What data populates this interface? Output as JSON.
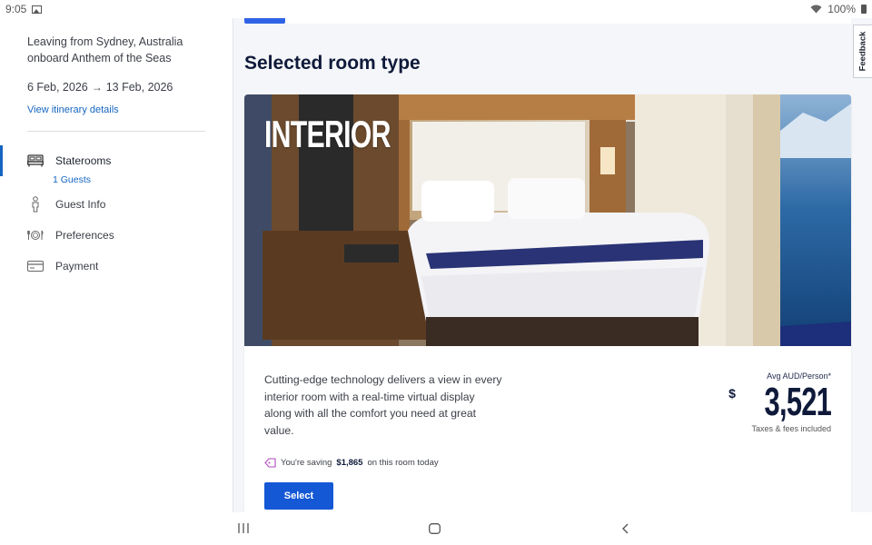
{
  "status_bar": {
    "time": "9:05",
    "battery": "100%"
  },
  "sidebar": {
    "trip_line1": "Leaving from Sydney, Australia",
    "trip_line2": "onboard Anthem of the Seas",
    "date_from": "6 Feb, 2026",
    "date_to": "13 Feb, 2026",
    "itinerary_link": "View itinerary details",
    "nav": [
      {
        "label": "Staterooms",
        "icon": "bed-icon",
        "active": true,
        "sub": "1 Guests"
      },
      {
        "label": "Guest Info",
        "icon": "person-icon"
      },
      {
        "label": "Preferences",
        "icon": "dining-icon"
      },
      {
        "label": "Payment",
        "icon": "credit-card-icon"
      }
    ]
  },
  "main": {
    "title": "Selected room type",
    "room": {
      "label": "INTERIOR",
      "description": "Cutting-edge technology delivers a view in every interior room with a real-time virtual display along with all the comfort you need at great value.",
      "avg_label": "Avg AUD/Person*",
      "currency_symbol": "$",
      "price": "3,521",
      "taxes_label": "Taxes & fees included",
      "saving_prefix": "You're saving",
      "saving_amount": "$1,865",
      "saving_suffix": "on this room today",
      "select_label": "Select"
    }
  },
  "feedback_label": "Feedback",
  "colors": {
    "accent": "#1558d6",
    "link": "#1565c0",
    "heading": "#0f1a3a"
  }
}
